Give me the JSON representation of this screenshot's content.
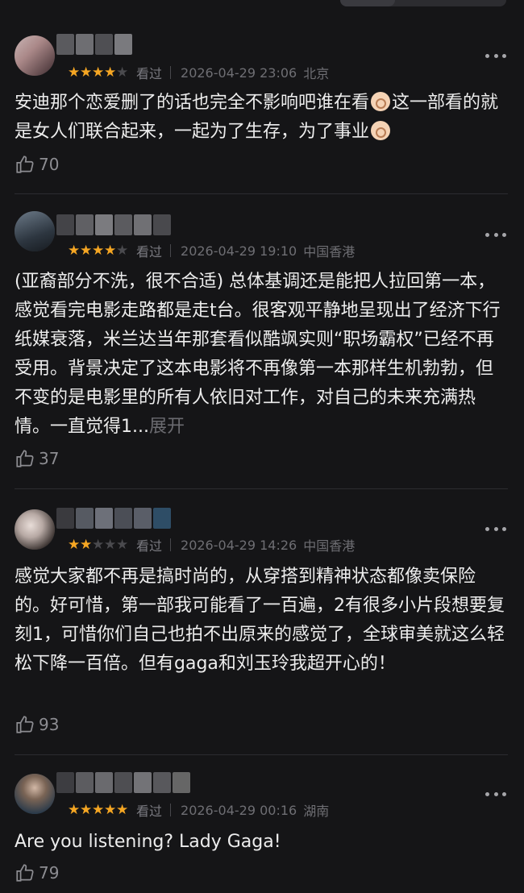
{
  "reviews": [
    {
      "stars": 4,
      "watched": "看过",
      "datetime": "2026-04-29 23:06",
      "location": "北京",
      "content_parts": [
        "安迪那个恋爱删了的话也完全不影响吧谁在看",
        "这一部看的就是女人们联合起来，一起为了生存，为了事业"
      ],
      "expand": "",
      "likes": "70"
    },
    {
      "stars": 4,
      "watched": "看过",
      "datetime": "2026-04-29 19:10",
      "location": "中国香港",
      "content_parts": [
        "(亚裔部分不洗，很不合适) 总体基调还是能把人拉回第一本，感觉看完电影走路都是走t台。很客观平静地呈现出了经济下行纸媒衰落，米兰达当年那套看似酷飒实则“职场霸权”已经不再受用。背景决定了这本电影将不再像第一本那样生机勃勃，但不变的是电影里的所有人依旧对工作，对自己的未来充满热情。一直觉得1..."
      ],
      "expand": "展开",
      "likes": "37"
    },
    {
      "stars": 2,
      "watched": "看过",
      "datetime": "2026-04-29 14:26",
      "location": "中国香港",
      "content_parts": [
        "感觉大家都不再是搞时尚的，从穿搭到精神状态都像卖保险的。好可惜，第一部我可能看了一百遍，2有很多小片段想要复刻1，可惜你们自己也拍不出原来的感觉了，全球审美就这么轻松下降一百倍。但有gaga和刘玉玲我超开心的！"
      ],
      "expand": "",
      "likes": "93"
    },
    {
      "stars": 5,
      "watched": "看过",
      "datetime": "2026-04-29 00:16",
      "location": "湖南",
      "content_parts": [
        "Are you listening? Lady Gaga!"
      ],
      "expand": "",
      "likes": "79"
    }
  ],
  "colors": {
    "star_on": "#f5a623",
    "star_off": "#4a4a4e",
    "background": "#151517"
  },
  "icons": {
    "like": "thumbs-up-icon",
    "more": "more-dots-icon"
  }
}
